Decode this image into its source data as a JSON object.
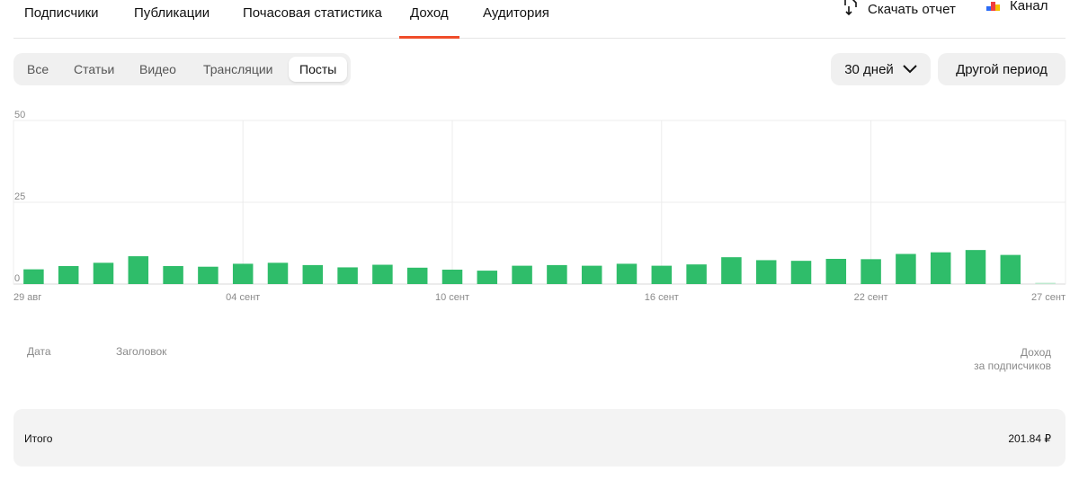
{
  "nav": {
    "tabs": [
      "Подписчики",
      "Публикации",
      "Почасовая статистика",
      "Доход",
      "Аудитория"
    ],
    "active": "Доход",
    "download_label": "Скачать отчет",
    "channel_label": "Канал"
  },
  "filters": {
    "segments": [
      "Все",
      "Статьи",
      "Видео",
      "Трансляции",
      "Посты"
    ],
    "active": "Посты",
    "period_label": "30 дней",
    "other_period_label": "Другой период"
  },
  "colors": {
    "accent": "#f04d2a",
    "bar": "#2fbd6a",
    "bar_last": "#bfe9cf"
  },
  "chart_data": {
    "type": "bar",
    "ylim": [
      0,
      50
    ],
    "y_ticks": [
      "50",
      "25",
      "0"
    ],
    "x_tick_labels": [
      "29 авг",
      "04 сент",
      "10 сент",
      "16 сент",
      "22 сент",
      "27 сент"
    ],
    "values": [
      4.5,
      5.5,
      6.5,
      8.5,
      5.5,
      5.3,
      6.2,
      6.5,
      5.8,
      5.1,
      5.9,
      5.0,
      4.4,
      4.1,
      5.6,
      5.8,
      5.6,
      6.2,
      5.6,
      6.0,
      8.2,
      7.3,
      7.1,
      7.7,
      7.6,
      9.2,
      9.7,
      10.4,
      8.9,
      0.4
    ]
  },
  "table": {
    "col_date": "Дата",
    "col_title": "Заголовок",
    "col_income_1": "Доход",
    "col_income_2": "за подписчиков",
    "total_label": "Итого",
    "total_value": "201.84 ₽"
  }
}
